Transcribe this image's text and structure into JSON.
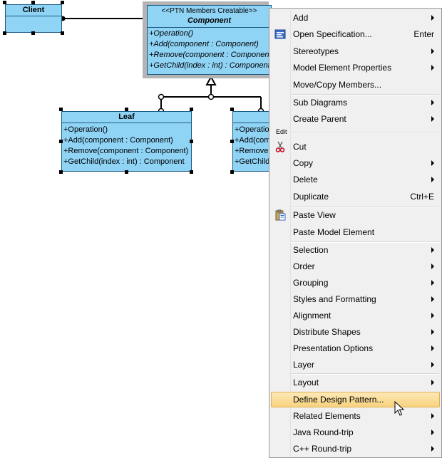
{
  "diagram": {
    "client": {
      "name": "Client"
    },
    "component": {
      "stereotype": "<<PTN Members Creatable>>",
      "name": "Component",
      "ops": [
        "+Operation()",
        "+Add(component : Component)",
        "+Remove(component : Component)",
        "+GetChild(index : int) : Component"
      ]
    },
    "leaf": {
      "name": "Leaf",
      "ops": [
        "+Operation()",
        "+Add(component : Component)",
        "+Remove(component : Component)",
        "+GetChild(index : int) : Component"
      ]
    },
    "composite": {
      "ops": [
        "+Operation()",
        "+Add(com",
        "+Remove",
        "+GetChild"
      ]
    }
  },
  "menu": {
    "group_label_edit": "Edit",
    "items": [
      {
        "label": "Add",
        "submenu": true
      },
      {
        "label": "Open Specification...",
        "shortcut": "Enter",
        "icon": "open-specification-icon"
      },
      {
        "label": "Stereotypes",
        "submenu": true
      },
      {
        "label": "Model Element Properties",
        "submenu": true
      },
      {
        "label": "Move/Copy Members..."
      },
      {
        "label": "Sub Diagrams",
        "submenu": true
      },
      {
        "label": "Create Parent",
        "submenu": true
      },
      {
        "label": "Cut",
        "icon": "scissors-icon"
      },
      {
        "label": "Copy",
        "submenu": true
      },
      {
        "label": "Delete",
        "submenu": true
      },
      {
        "label": "Duplicate",
        "shortcut": "Ctrl+E"
      },
      {
        "label": "Paste View",
        "icon": "paste-icon"
      },
      {
        "label": "Paste Model Element"
      },
      {
        "label": "Selection",
        "submenu": true
      },
      {
        "label": "Order",
        "submenu": true
      },
      {
        "label": "Grouping",
        "submenu": true
      },
      {
        "label": "Styles and Formatting",
        "submenu": true
      },
      {
        "label": "Alignment",
        "submenu": true
      },
      {
        "label": "Distribute Shapes",
        "submenu": true
      },
      {
        "label": "Presentation Options",
        "submenu": true
      },
      {
        "label": "Layer",
        "submenu": true
      },
      {
        "label": "Layout",
        "submenu": true
      },
      {
        "label": "Define Design Pattern...",
        "highlighted": true
      },
      {
        "label": "Related Elements",
        "submenu": true
      },
      {
        "label": "Java Round-trip",
        "submenu": true
      },
      {
        "label": "C++ Round-trip",
        "submenu": true
      }
    ]
  }
}
